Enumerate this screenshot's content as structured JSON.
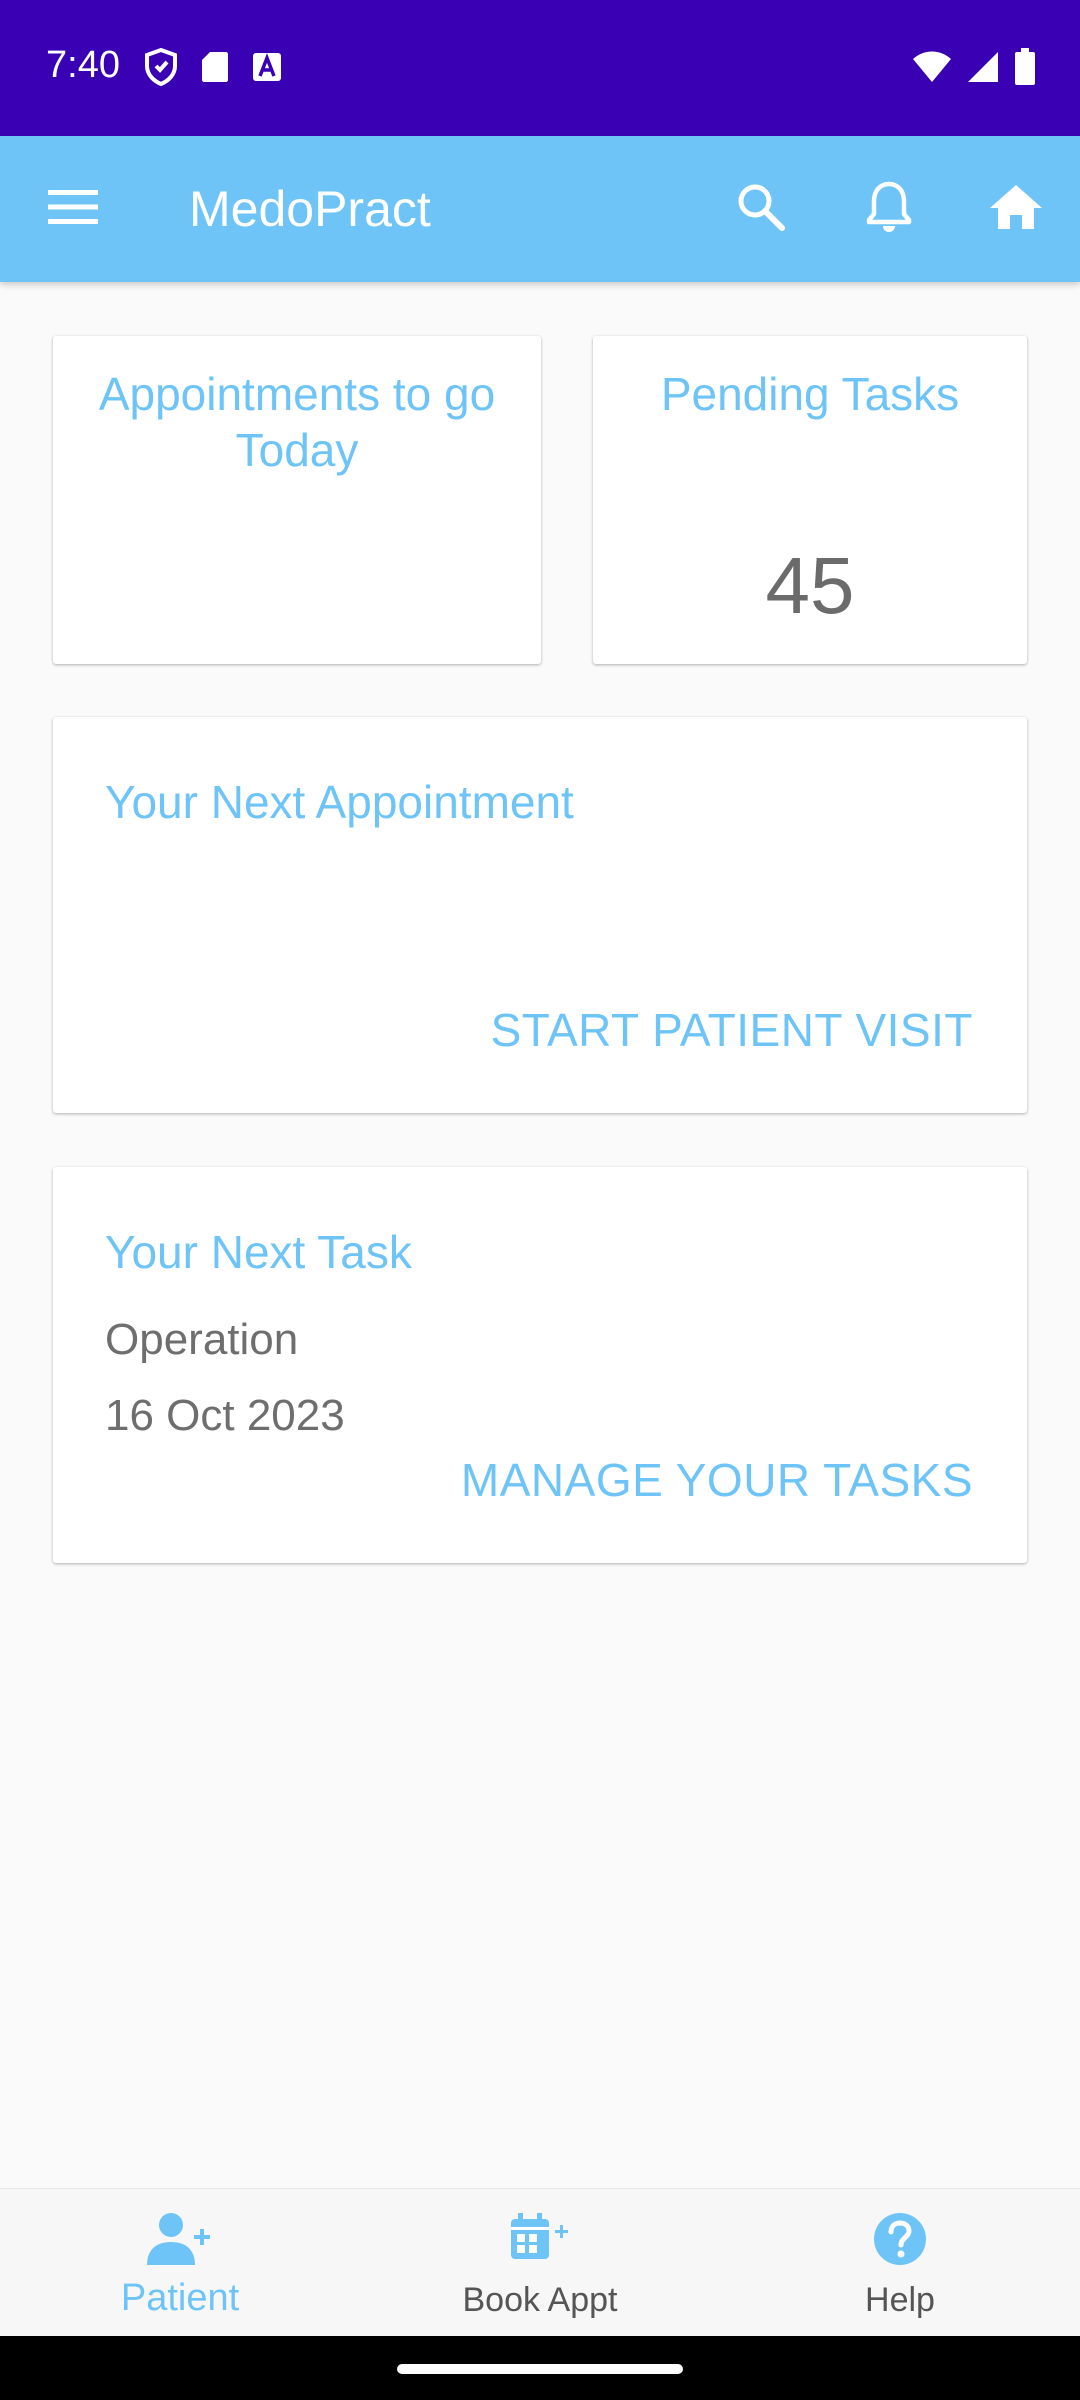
{
  "status_bar": {
    "time": "7:40",
    "left_icons": [
      "shield-icon",
      "sd-card-icon",
      "font-a-icon"
    ],
    "right_icons": [
      "wifi-icon",
      "signal-icon",
      "battery-icon"
    ]
  },
  "app_bar": {
    "title": "MedoPract",
    "icons": [
      "menu-icon",
      "search-icon",
      "bell-icon",
      "home-icon"
    ]
  },
  "cards": {
    "appointments_today": {
      "title": "Appointments to go Today",
      "value": ""
    },
    "pending_tasks": {
      "title": "Pending Tasks",
      "value": "45"
    },
    "next_appointment": {
      "title": "Your Next Appointment",
      "action": "START PATIENT VISIT"
    },
    "next_task": {
      "title": "Your Next Task",
      "task_name": "Operation",
      "task_date": "16 Oct 2023",
      "action": "MANAGE YOUR TASKS"
    }
  },
  "bottom_nav": {
    "items": [
      {
        "label": "Patient",
        "icon": "add-person-icon",
        "active": true
      },
      {
        "label": "Book Appt",
        "icon": "calendar-add-icon",
        "active": false
      },
      {
        "label": "Help",
        "icon": "help-icon",
        "active": false
      }
    ]
  },
  "colors": {
    "status_bar": "#3a00b3",
    "app_bar": "#6ec4f7",
    "accent": "#6ec4f7",
    "text_gray": "#6b6b6b",
    "background": "#fafafa"
  }
}
